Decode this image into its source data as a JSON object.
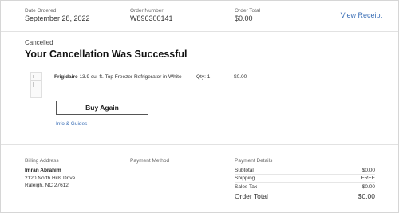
{
  "header": {
    "date_label": "Date Ordered",
    "date_value": "September 28, 2022",
    "order_number_label": "Order Number",
    "order_number_value": "W896300141",
    "order_total_label": "Order Total",
    "order_total_value": "$0.00",
    "view_receipt": "View Receipt"
  },
  "status": {
    "label": "Cancelled",
    "title": "Your Cancellation Was Successful"
  },
  "item": {
    "brand": "Frigidaire",
    "description": "13.9 cu. ft. Top Freezer Refrigerator in White",
    "qty": "Qty: 1",
    "price": "$0.00",
    "buy_again": "Buy Again",
    "info_link": "Info & Guides"
  },
  "billing": {
    "label": "Billing Address",
    "name": "Imran Abrahim",
    "line1": "2120 North Hills Drive",
    "line2": "Raleigh, NC 27612"
  },
  "payment_method": {
    "label": "Payment Method"
  },
  "payment_details": {
    "label": "Payment Details",
    "rows": [
      {
        "key": "Subtotal",
        "value": "$0.00"
      },
      {
        "key": "Shipping",
        "value": "FREE"
      },
      {
        "key": "Sales Tax",
        "value": "$0.00"
      },
      {
        "key": "Order Total",
        "value": "$0.00"
      }
    ]
  },
  "colors": {
    "link": "#3b6fb6",
    "border": "#d6d6d6",
    "text": "#222222"
  }
}
